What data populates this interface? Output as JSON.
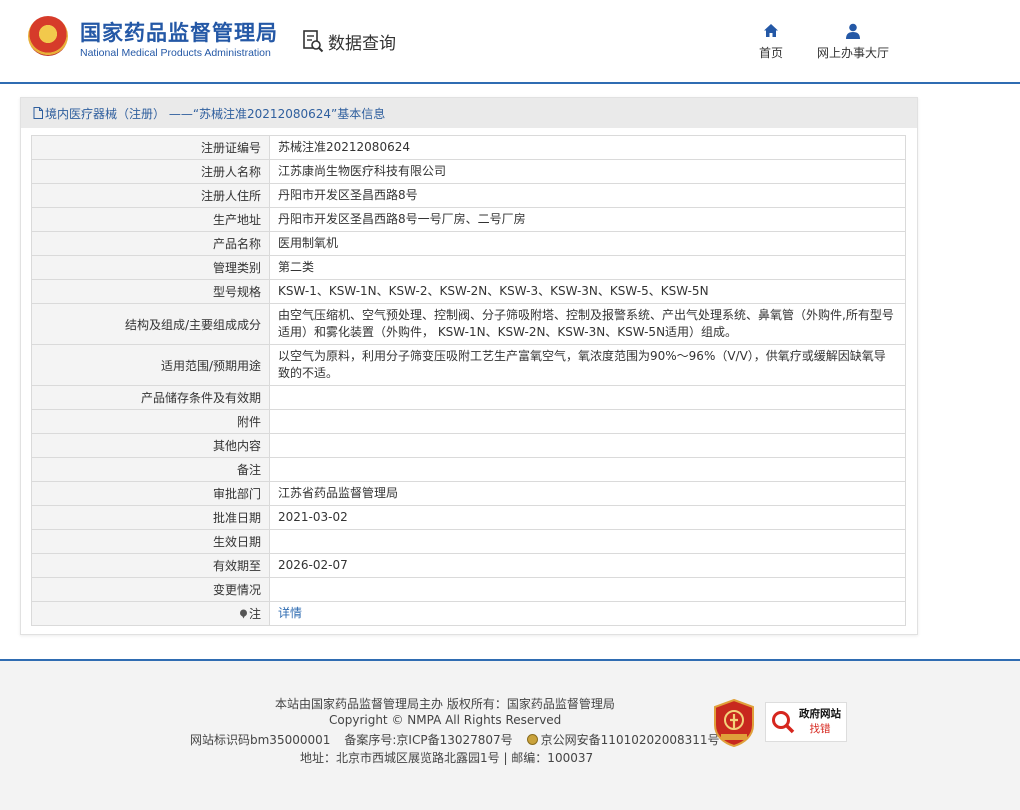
{
  "header": {
    "logo_cn": "国家药品监督管理局",
    "logo_en": "National Medical Products Administration",
    "query_label": "数据查询",
    "nav": [
      {
        "label": "首页",
        "icon": "home-icon"
      },
      {
        "label": "网上办事大厅",
        "icon": "user-icon"
      }
    ]
  },
  "panel": {
    "title": "境内医疗器械（注册） ——“苏械注准20212080624”基本信息",
    "rows": [
      {
        "key": "注册证编号",
        "value": "苏械注准20212080624"
      },
      {
        "key": "注册人名称",
        "value": "江苏康尚生物医疗科技有限公司"
      },
      {
        "key": "注册人住所",
        "value": "丹阳市开发区圣昌西路8号"
      },
      {
        "key": "生产地址",
        "value": "丹阳市开发区圣昌西路8号一号厂房、二号厂房"
      },
      {
        "key": "产品名称",
        "value": "医用制氧机"
      },
      {
        "key": "管理类别",
        "value": "第二类"
      },
      {
        "key": "型号规格",
        "value": "KSW-1、KSW-1N、KSW-2、KSW-2N、KSW-3、KSW-3N、KSW-5、KSW-5N"
      },
      {
        "key": "结构及组成/主要组成成分",
        "value": "由空气压缩机、空气预处理、控制阀、分子筛吸附塔、控制及报警系统、产出气处理系统、鼻氧管（外购件,所有型号适用）和雾化装置（外购件， KSW-1N、KSW-2N、KSW-3N、KSW-5N适用）组成。"
      },
      {
        "key": "适用范围/预期用途",
        "value": "以空气为原料，利用分子筛变压吸附工艺生产富氧空气，氧浓度范围为90%～96%（V/V），供氧疗或缓解因缺氧导致的不适。"
      },
      {
        "key": "产品储存条件及有效期",
        "value": ""
      },
      {
        "key": "附件",
        "value": ""
      },
      {
        "key": "其他内容",
        "value": ""
      },
      {
        "key": "备注",
        "value": ""
      },
      {
        "key": "审批部门",
        "value": "江苏省药品监督管理局"
      },
      {
        "key": "批准日期",
        "value": "2021-03-02"
      },
      {
        "key": "生效日期",
        "value": ""
      },
      {
        "key": "有效期至",
        "value": "2026-02-07"
      },
      {
        "key": "变更情况",
        "value": ""
      }
    ],
    "note_key": "注",
    "note_link": "详情"
  },
  "footer": {
    "line1": "本站由国家药品监督管理局主办 版权所有：国家药品监督管理局",
    "line2": "Copyright © NMPA All Rights Reserved",
    "site_id": "网站标识码bm35000001",
    "icp": "备案序号:京ICP备13027807号",
    "police": "京公网安备11010202008311号",
    "address": "地址：北京市西城区展览路北露园1号 | 邮编：100037",
    "badge_gov_line1": "政府网站",
    "badge_gov_line2": "找错",
    "colors": {
      "accent": "#2f6cb2",
      "badge_red": "#d6261e"
    }
  }
}
